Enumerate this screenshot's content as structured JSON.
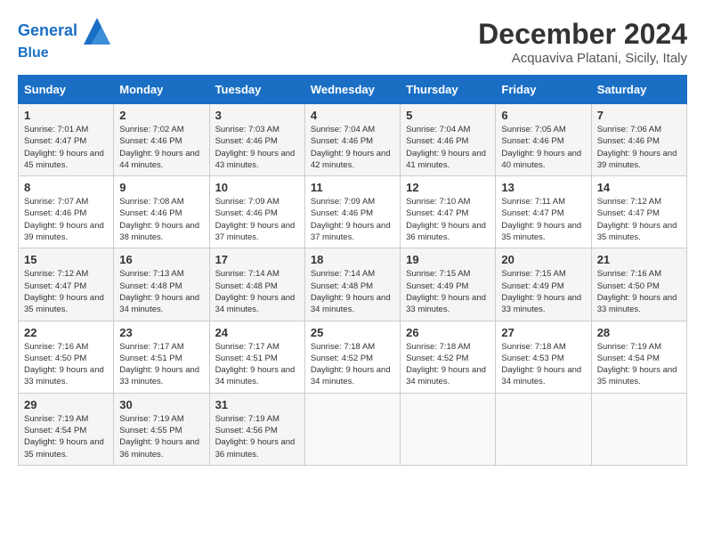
{
  "header": {
    "logo_line1": "General",
    "logo_line2": "Blue",
    "title": "December 2024",
    "location": "Acquaviva Platani, Sicily, Italy"
  },
  "weekdays": [
    "Sunday",
    "Monday",
    "Tuesday",
    "Wednesday",
    "Thursday",
    "Friday",
    "Saturday"
  ],
  "weeks": [
    [
      {
        "day": "1",
        "sunrise": "Sunrise: 7:01 AM",
        "sunset": "Sunset: 4:47 PM",
        "daylight": "Daylight: 9 hours and 45 minutes."
      },
      {
        "day": "2",
        "sunrise": "Sunrise: 7:02 AM",
        "sunset": "Sunset: 4:46 PM",
        "daylight": "Daylight: 9 hours and 44 minutes."
      },
      {
        "day": "3",
        "sunrise": "Sunrise: 7:03 AM",
        "sunset": "Sunset: 4:46 PM",
        "daylight": "Daylight: 9 hours and 43 minutes."
      },
      {
        "day": "4",
        "sunrise": "Sunrise: 7:04 AM",
        "sunset": "Sunset: 4:46 PM",
        "daylight": "Daylight: 9 hours and 42 minutes."
      },
      {
        "day": "5",
        "sunrise": "Sunrise: 7:04 AM",
        "sunset": "Sunset: 4:46 PM",
        "daylight": "Daylight: 9 hours and 41 minutes."
      },
      {
        "day": "6",
        "sunrise": "Sunrise: 7:05 AM",
        "sunset": "Sunset: 4:46 PM",
        "daylight": "Daylight: 9 hours and 40 minutes."
      },
      {
        "day": "7",
        "sunrise": "Sunrise: 7:06 AM",
        "sunset": "Sunset: 4:46 PM",
        "daylight": "Daylight: 9 hours and 39 minutes."
      }
    ],
    [
      {
        "day": "8",
        "sunrise": "Sunrise: 7:07 AM",
        "sunset": "Sunset: 4:46 PM",
        "daylight": "Daylight: 9 hours and 39 minutes."
      },
      {
        "day": "9",
        "sunrise": "Sunrise: 7:08 AM",
        "sunset": "Sunset: 4:46 PM",
        "daylight": "Daylight: 9 hours and 38 minutes."
      },
      {
        "day": "10",
        "sunrise": "Sunrise: 7:09 AM",
        "sunset": "Sunset: 4:46 PM",
        "daylight": "Daylight: 9 hours and 37 minutes."
      },
      {
        "day": "11",
        "sunrise": "Sunrise: 7:09 AM",
        "sunset": "Sunset: 4:46 PM",
        "daylight": "Daylight: 9 hours and 37 minutes."
      },
      {
        "day": "12",
        "sunrise": "Sunrise: 7:10 AM",
        "sunset": "Sunset: 4:47 PM",
        "daylight": "Daylight: 9 hours and 36 minutes."
      },
      {
        "day": "13",
        "sunrise": "Sunrise: 7:11 AM",
        "sunset": "Sunset: 4:47 PM",
        "daylight": "Daylight: 9 hours and 35 minutes."
      },
      {
        "day": "14",
        "sunrise": "Sunrise: 7:12 AM",
        "sunset": "Sunset: 4:47 PM",
        "daylight": "Daylight: 9 hours and 35 minutes."
      }
    ],
    [
      {
        "day": "15",
        "sunrise": "Sunrise: 7:12 AM",
        "sunset": "Sunset: 4:47 PM",
        "daylight": "Daylight: 9 hours and 35 minutes."
      },
      {
        "day": "16",
        "sunrise": "Sunrise: 7:13 AM",
        "sunset": "Sunset: 4:48 PM",
        "daylight": "Daylight: 9 hours and 34 minutes."
      },
      {
        "day": "17",
        "sunrise": "Sunrise: 7:14 AM",
        "sunset": "Sunset: 4:48 PM",
        "daylight": "Daylight: 9 hours and 34 minutes."
      },
      {
        "day": "18",
        "sunrise": "Sunrise: 7:14 AM",
        "sunset": "Sunset: 4:48 PM",
        "daylight": "Daylight: 9 hours and 34 minutes."
      },
      {
        "day": "19",
        "sunrise": "Sunrise: 7:15 AM",
        "sunset": "Sunset: 4:49 PM",
        "daylight": "Daylight: 9 hours and 33 minutes."
      },
      {
        "day": "20",
        "sunrise": "Sunrise: 7:15 AM",
        "sunset": "Sunset: 4:49 PM",
        "daylight": "Daylight: 9 hours and 33 minutes."
      },
      {
        "day": "21",
        "sunrise": "Sunrise: 7:16 AM",
        "sunset": "Sunset: 4:50 PM",
        "daylight": "Daylight: 9 hours and 33 minutes."
      }
    ],
    [
      {
        "day": "22",
        "sunrise": "Sunrise: 7:16 AM",
        "sunset": "Sunset: 4:50 PM",
        "daylight": "Daylight: 9 hours and 33 minutes."
      },
      {
        "day": "23",
        "sunrise": "Sunrise: 7:17 AM",
        "sunset": "Sunset: 4:51 PM",
        "daylight": "Daylight: 9 hours and 33 minutes."
      },
      {
        "day": "24",
        "sunrise": "Sunrise: 7:17 AM",
        "sunset": "Sunset: 4:51 PM",
        "daylight": "Daylight: 9 hours and 34 minutes."
      },
      {
        "day": "25",
        "sunrise": "Sunrise: 7:18 AM",
        "sunset": "Sunset: 4:52 PM",
        "daylight": "Daylight: 9 hours and 34 minutes."
      },
      {
        "day": "26",
        "sunrise": "Sunrise: 7:18 AM",
        "sunset": "Sunset: 4:52 PM",
        "daylight": "Daylight: 9 hours and 34 minutes."
      },
      {
        "day": "27",
        "sunrise": "Sunrise: 7:18 AM",
        "sunset": "Sunset: 4:53 PM",
        "daylight": "Daylight: 9 hours and 34 minutes."
      },
      {
        "day": "28",
        "sunrise": "Sunrise: 7:19 AM",
        "sunset": "Sunset: 4:54 PM",
        "daylight": "Daylight: 9 hours and 35 minutes."
      }
    ],
    [
      {
        "day": "29",
        "sunrise": "Sunrise: 7:19 AM",
        "sunset": "Sunset: 4:54 PM",
        "daylight": "Daylight: 9 hours and 35 minutes."
      },
      {
        "day": "30",
        "sunrise": "Sunrise: 7:19 AM",
        "sunset": "Sunset: 4:55 PM",
        "daylight": "Daylight: 9 hours and 36 minutes."
      },
      {
        "day": "31",
        "sunrise": "Sunrise: 7:19 AM",
        "sunset": "Sunset: 4:56 PM",
        "daylight": "Daylight: 9 hours and 36 minutes."
      },
      null,
      null,
      null,
      null
    ]
  ]
}
